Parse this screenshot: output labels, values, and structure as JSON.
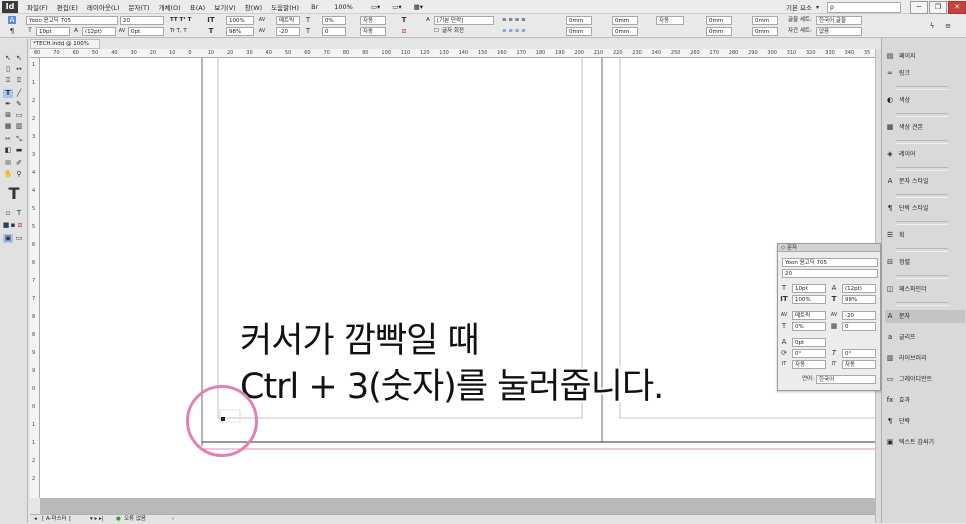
{
  "app": {
    "logo": "Id"
  },
  "menu": [
    "파일(F)",
    "편집(E)",
    "레이아웃(L)",
    "문자(T)",
    "개체(O)",
    "표(A)",
    "보기(V)",
    "창(W)",
    "도움말(H)"
  ],
  "menu_right": {
    "zoom": "100%",
    "workspace": "기본 요소",
    "search_placeholder": "ρ",
    "minimize": "─",
    "restore": "❐",
    "close": "✕"
  },
  "control": {
    "font_family": "Yoon 윤고딕 705",
    "font_style": "20",
    "font_size": "10pt",
    "leading": "(12pt)",
    "kerning": "0",
    "tracking": "0pt",
    "hscale": "100%",
    "vscale": "98%",
    "baseline": "메트릭",
    "baseline2": "-20",
    "skew": "0%",
    "skew2": "0",
    "auto1": "자동",
    "auto2": "자동",
    "char_style": "[기본 단락]",
    "rotate_label": "글자 회전",
    "indent1": "0mm",
    "indent2": "0mm",
    "indent3": "0mm",
    "indent4": "0mm",
    "auto3": "자동",
    "indent5": "0mm",
    "indent6": "0mm",
    "indent7": "0mm",
    "indent8": "0mm",
    "lang_label": "글꼴 세트:",
    "lang_value": "한국어 글꼴",
    "kinsoku_label": "자간 세트:",
    "kinsoku_value": "없음"
  },
  "document_tab": "*TECH.indd @ 100%",
  "ruler": {
    "h_ticks": [
      "80",
      "70",
      "60",
      "50",
      "40",
      "30",
      "20",
      "10",
      "0",
      "10",
      "20",
      "30",
      "40",
      "50",
      "60",
      "70",
      "80",
      "90",
      "100",
      "110",
      "120",
      "130",
      "140",
      "150",
      "160",
      "170",
      "180",
      "190",
      "200",
      "210",
      "220",
      "230",
      "240",
      "250",
      "260",
      "270",
      "280",
      "290",
      "300",
      "310",
      "320",
      "330",
      "340",
      "35"
    ],
    "v_ticks": [
      "1",
      "1",
      "2",
      "2",
      "3",
      "3",
      "4",
      "4",
      "5",
      "5",
      "6",
      "6",
      "7",
      "7",
      "8",
      "8",
      "9",
      "9",
      "0",
      "0",
      "1",
      "1",
      "2",
      "2"
    ]
  },
  "overlay": {
    "line1": "커서가 깜빡일 때",
    "line2": "Ctrl + 3(숫자)를 눌러줍니다."
  },
  "status": {
    "page": "[ A-마스터 ]",
    "preflight": "오류 없음"
  },
  "dock": {
    "items": [
      {
        "label": "페이지",
        "icon": "pages-icon"
      },
      {
        "label": "링크",
        "icon": "links-icon"
      },
      {
        "label": "색상",
        "icon": "color-icon"
      },
      {
        "label": "색상 견본",
        "icon": "swatches-icon"
      },
      {
        "label": "레이어",
        "icon": "layers-icon"
      },
      {
        "label": "문자 스타일",
        "icon": "char-styles-icon"
      },
      {
        "label": "단락 스타일",
        "icon": "para-styles-icon"
      },
      {
        "label": "획",
        "icon": "stroke-icon"
      },
      {
        "label": "정렬",
        "icon": "align-icon"
      },
      {
        "label": "패스파인더",
        "icon": "pathfinder-icon"
      },
      {
        "label": "문자",
        "icon": "character-icon"
      },
      {
        "label": "글리프",
        "icon": "glyphs-icon"
      },
      {
        "label": "라이브러리",
        "icon": "library-icon"
      },
      {
        "label": "그레이디언트",
        "icon": "gradient-icon"
      },
      {
        "label": "효과",
        "icon": "effects-icon"
      },
      {
        "label": "단락",
        "icon": "paragraph-icon"
      },
      {
        "label": "텍스트 감싸기",
        "icon": "text-wrap-icon"
      }
    ]
  },
  "char_panel": {
    "title": "◇ 문자",
    "font_family": "Yoon 윤고딕 705",
    "font_style": "20",
    "size": "10pt",
    "leading": "(12pt)",
    "vscale": "100%",
    "hscale": "98%",
    "kerning": "메트릭",
    "tracking": "-20",
    "tsume": "0%",
    "grid": "0",
    "baseline": "0pt",
    "skew": "0°",
    "rotate": "0°",
    "auto1": "자동",
    "auto2": "자동",
    "lang_label": "언어:",
    "lang_value": "한국어"
  }
}
